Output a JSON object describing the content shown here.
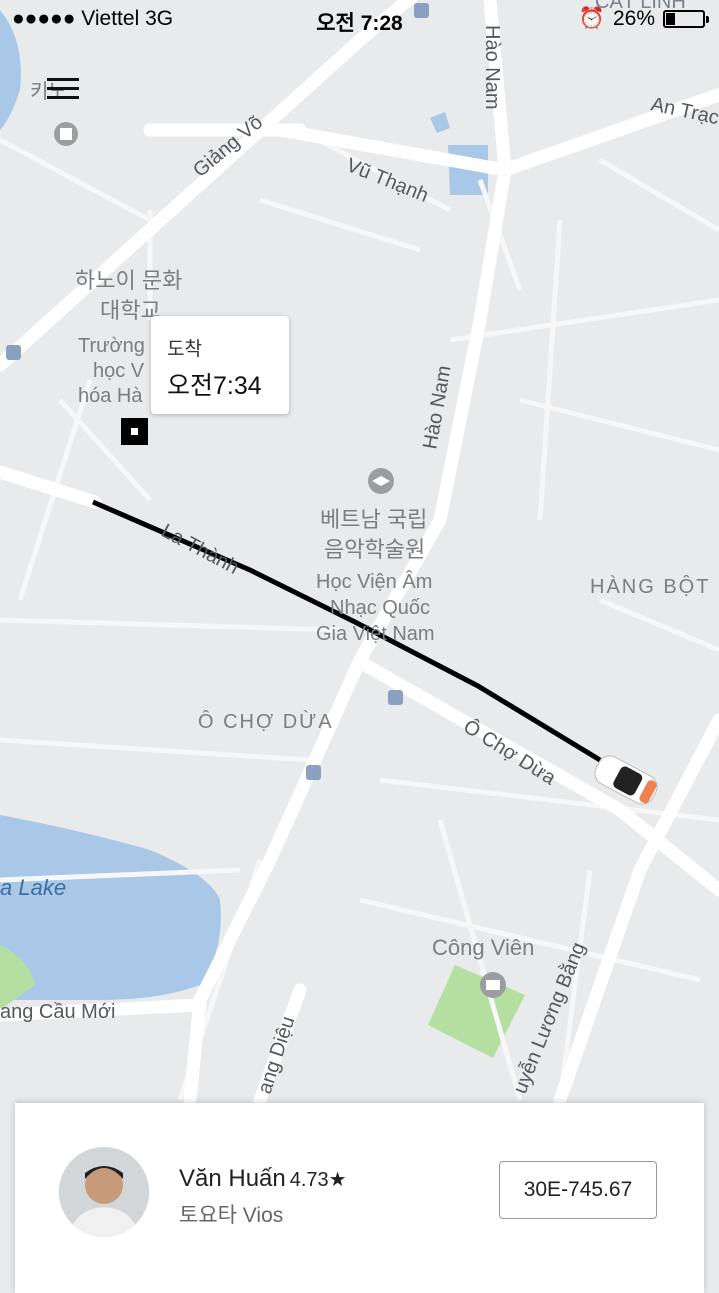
{
  "status_bar": {
    "carrier": "●●●●● Viettel  3G",
    "time": "오전 7:28",
    "battery": "26%",
    "battery_level": 0.26
  },
  "map": {
    "labels": {
      "giang_vo": "Giảng Võ",
      "vu_thanh": "Vũ Thạnh",
      "hao_nam_top": "Hào Nam",
      "hao_nam_mid": "Hào Nam",
      "an_trach": "An Trạc",
      "cat_linh": "CÁT LINH",
      "ha_noi_culture_ko_1": "하노이 문화",
      "ha_noi_culture_ko_2": "대학교",
      "truong_1": "Trường",
      "truong_2": "học V",
      "truong_3": "hóa Hà",
      "la_thanh": "La Thành",
      "music_ko_1": "베트남 국립",
      "music_ko_2": "음악학술원",
      "music_vi_1": "Học Viện Âm",
      "music_vi_2": "Nhạc Quốc",
      "music_vi_3": "Gia Việt Nam",
      "hang_bot": "HÀNG BỘT",
      "o_cho_dua_area": "Ô CHỢ DỪA",
      "o_cho_dua_street": "Ô Chợ Dừa",
      "lake": "a Lake",
      "cau_moi": "ang Cầu Mới",
      "cong_vien": "Công Viên",
      "nguyen_luong_bang": "uyễn Lương Bằng",
      "hoang_dieu": "ang Diệu",
      "kino": "키노"
    }
  },
  "eta": {
    "label": "도착",
    "time": "오전7:34"
  },
  "driver": {
    "name": "Văn Huấn",
    "rating": "4.73★",
    "car": "토요타 Vios",
    "plate": "30E-745.67"
  }
}
